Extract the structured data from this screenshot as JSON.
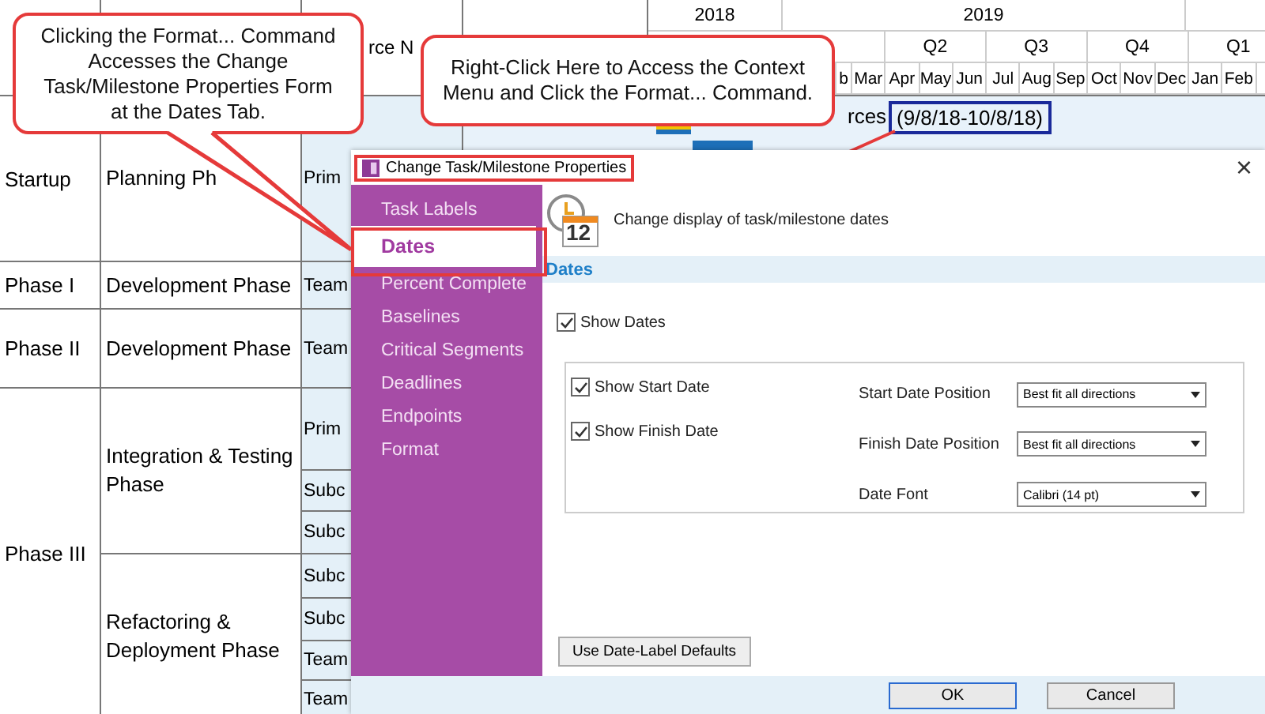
{
  "table": {
    "resource_header": "rce N",
    "years": [
      "2018",
      "2019"
    ],
    "quarters": [
      "Q2",
      "Q3",
      "Q4",
      "Q1"
    ],
    "months": [
      "b",
      "Mar",
      "Apr",
      "May",
      "Jun",
      "Jul",
      "Aug",
      "Sep",
      "Oct",
      "Nov",
      "Dec",
      "Jan",
      "Feb"
    ],
    "groups": [
      {
        "phase": "Startup",
        "activities": [
          {
            "name": "Planning Ph",
            "resources": [
              "Prim"
            ]
          }
        ]
      },
      {
        "phase": "Phase I",
        "activities": [
          {
            "name": "Development Phase",
            "resources": [
              "Team"
            ]
          }
        ]
      },
      {
        "phase": "Phase II",
        "activities": [
          {
            "name": "Development Phase",
            "resources": [
              "Team"
            ]
          }
        ]
      },
      {
        "phase": "Phase III",
        "activities": [
          {
            "name": "Integration & Testing Phase",
            "resources": [
              "Prim",
              "Subc",
              "Subc"
            ]
          },
          {
            "name": "Refactoring & Deployment Phase",
            "resources": [
              "Subc",
              "Subc",
              "Team",
              "Team"
            ]
          }
        ]
      }
    ]
  },
  "gantt": {
    "bar_label": "rces",
    "date_label": "(9/8/18-10/8/18)"
  },
  "callouts": [
    {
      "text": "Clicking the Format... Command Accesses the Change Task/Milestone Properties Form at the Dates Tab."
    },
    {
      "text": "Right-Click Here to Access the Context Menu and Click the Format... Command."
    }
  ],
  "dialog": {
    "title": "Change Task/Milestone Properties",
    "close": "×",
    "tabs": [
      {
        "label": "Task Labels",
        "selected": false
      },
      {
        "label": "Dates",
        "selected": true
      },
      {
        "label": "Percent Complete",
        "selected": false
      },
      {
        "label": "Baselines",
        "selected": false
      },
      {
        "label": "Critical Segments",
        "selected": false
      },
      {
        "label": "Deadlines",
        "selected": false
      },
      {
        "label": "Endpoints",
        "selected": false
      },
      {
        "label": "Format",
        "selected": false
      }
    ],
    "icon_day": "12",
    "heading": "Change display of task/milestone dates",
    "section": "Dates",
    "show_dates": {
      "label": "Show Dates",
      "checked": true
    },
    "options": [
      {
        "label": "Show Start Date",
        "checked": true
      },
      {
        "label": "Show Finish Date",
        "checked": true
      }
    ],
    "settings": [
      {
        "label": "Start Date Position",
        "value": "Best fit all directions"
      },
      {
        "label": "Finish Date Position",
        "value": "Best fit all directions"
      },
      {
        "label": "Date Font",
        "value": "Calibri (14 pt)"
      }
    ],
    "defaults_button": "Use Date-Label Defaults",
    "buttons": [
      "OK",
      "Cancel"
    ]
  }
}
